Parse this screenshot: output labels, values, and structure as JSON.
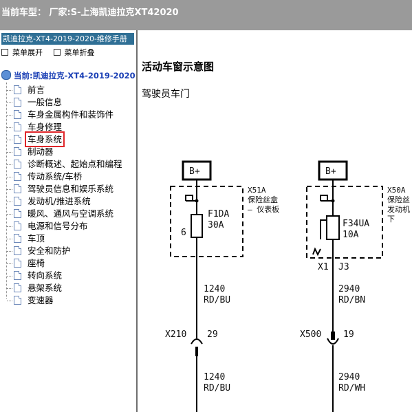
{
  "titlebar": {
    "text": "当前车型： 厂家:S-上海凯迪拉克XT42020"
  },
  "sidebar": {
    "manual_title": "凯迪拉克-XT4-2019-2020-维修手册",
    "expand_label": "菜单展开",
    "collapse_label": "菜单折叠",
    "root_label": "当前:凯迪拉克-XT4-2019-2020",
    "items": [
      {
        "label": "前言"
      },
      {
        "label": "一般信息"
      },
      {
        "label": "车身金属构件和装饰件"
      },
      {
        "label": "车身修理"
      },
      {
        "label": "车身系统",
        "selected": true
      },
      {
        "label": "制动器"
      },
      {
        "label": "诊断概述、起始点和编程"
      },
      {
        "label": "传动系统/车桥"
      },
      {
        "label": "驾驶员信息和娱乐系统"
      },
      {
        "label": "发动机/推进系统"
      },
      {
        "label": "暖风、通风与空调系统"
      },
      {
        "label": "电源和信号分布"
      },
      {
        "label": "车顶"
      },
      {
        "label": "安全和防护"
      },
      {
        "label": "座椅"
      },
      {
        "label": "转向系统"
      },
      {
        "label": "悬架系统"
      },
      {
        "label": "变速器"
      }
    ]
  },
  "content": {
    "title": "活动车窗示意图",
    "subtitle": "驾驶员车门",
    "diagram": {
      "left": {
        "power": "B+",
        "fuse_block_id": "X51A",
        "fuse_block_line1": "保险丝盒",
        "fuse_block_line2": "– 仪表板",
        "fuse_name": "F1DA",
        "fuse_rating": "30A",
        "pin": "6",
        "wire1_circuit": "1240",
        "wire1_color": "RD/BU",
        "connector": "X210",
        "connector_pin": "29",
        "wire2_circuit": "1240",
        "wire2_color": "RD/BU"
      },
      "right": {
        "power": "B+",
        "fuse_block_id": "X50A",
        "fuse_block_line1": "保险丝",
        "fuse_block_line2": "发动机",
        "fuse_block_line3": "下",
        "fuse_name": "F34UA",
        "fuse_rating": "10A",
        "pin_left": "X1",
        "pin_right": "J3",
        "wire1_circuit": "2940",
        "wire1_color": "RD/BN",
        "connector": "X500",
        "connector_pin": "19",
        "wire2_circuit": "2940",
        "wire2_color": "RD/WH"
      }
    }
  }
}
